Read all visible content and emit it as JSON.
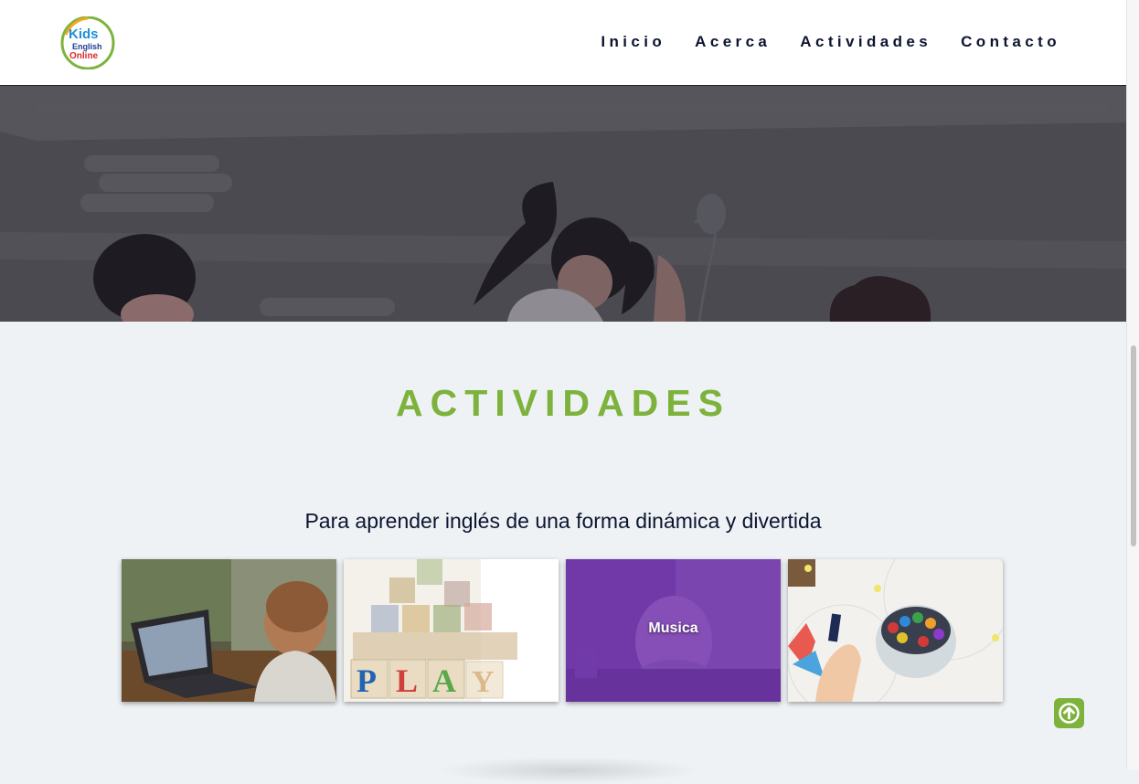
{
  "header": {
    "logo_text": [
      "Kids",
      "English",
      "Online"
    ],
    "nav": [
      {
        "label": "Inicio"
      },
      {
        "label": "Acerca"
      },
      {
        "label": "Actividades"
      },
      {
        "label": "Contacto"
      }
    ]
  },
  "section": {
    "title": "ACTIVIDADES",
    "subtitle": "Para aprender inglés de una forma dinámica y divertida",
    "cards": [
      {
        "image": "child-laptop-photo",
        "label": ""
      },
      {
        "image": "play-blocks-photo",
        "label": ""
      },
      {
        "image": "girl-headphones-photo",
        "label": "Musica"
      },
      {
        "image": "crayons-drawing-photo",
        "label": ""
      }
    ]
  },
  "scroll_top": {
    "icon": "arrow-up-icon"
  },
  "colors": {
    "accent_green": "#7db33c",
    "nav_text": "#0c1530",
    "hero_overlay": "#4a4a50",
    "music_overlay": "#7a2fb5",
    "page_bg": "#eef2f5"
  }
}
